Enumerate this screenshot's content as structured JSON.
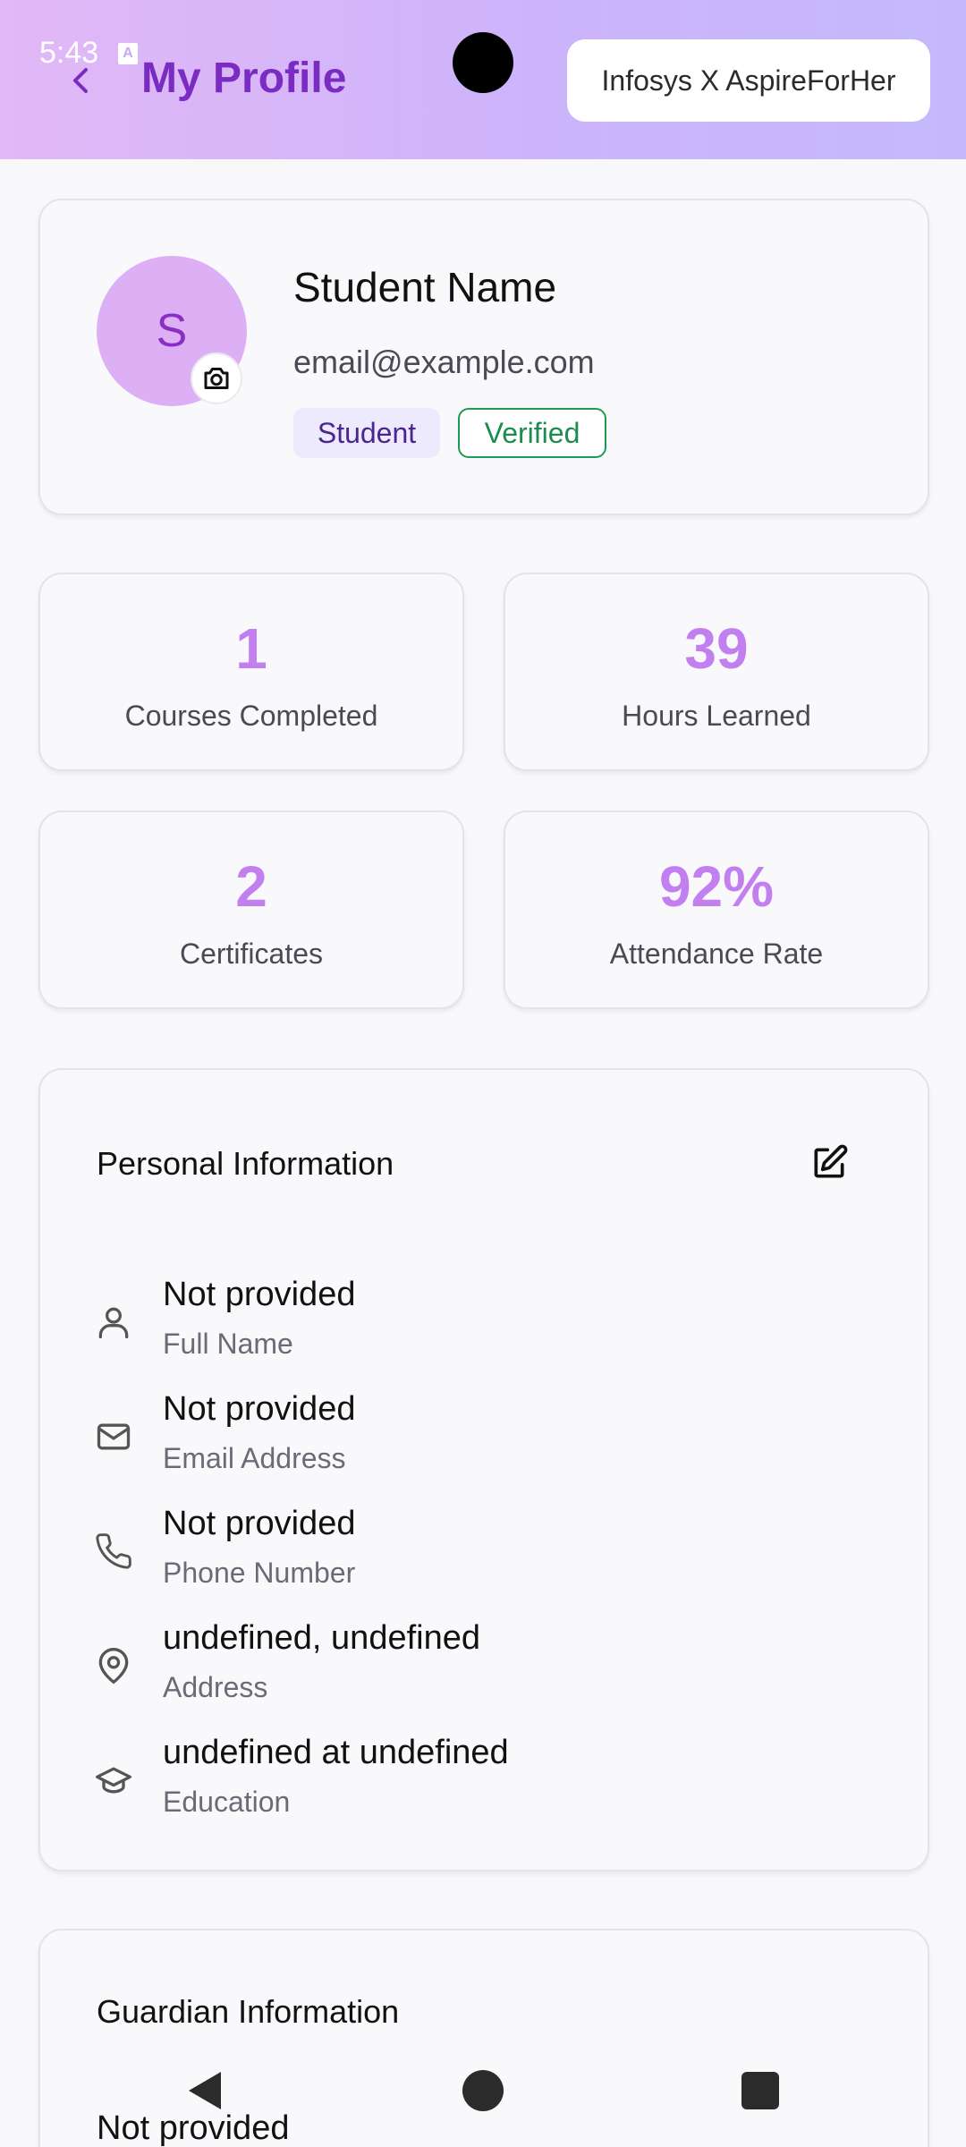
{
  "status_bar": {
    "time": "5:43",
    "notification_glyph": "A"
  },
  "header": {
    "title": "My Profile",
    "brand": "Infosys X AspireForHer",
    "gradient": [
      "#e2b8f7",
      "#c4b8fb"
    ]
  },
  "profile": {
    "avatar_initial": "S",
    "name": "Student Name",
    "email": "email@example.com",
    "role_badge": "Student",
    "status_badge": "Verified"
  },
  "stats": [
    {
      "value": "1",
      "label": "Courses Completed"
    },
    {
      "value": "39",
      "label": "Hours Learned"
    },
    {
      "value": "2",
      "label": "Certificates"
    },
    {
      "value": "92%",
      "label": "Attendance Rate"
    }
  ],
  "personal_info": {
    "title": "Personal Information",
    "rows": [
      {
        "icon": "user-icon",
        "value": "Not provided",
        "label": "Full Name"
      },
      {
        "icon": "mail-icon",
        "value": "Not provided",
        "label": "Email Address"
      },
      {
        "icon": "phone-icon",
        "value": "Not provided",
        "label": "Phone Number"
      },
      {
        "icon": "map-pin-icon",
        "value": "undefined, undefined",
        "label": "Address"
      },
      {
        "icon": "graduation-cap-icon",
        "value": "undefined at undefined",
        "label": "Education"
      }
    ]
  },
  "guardian_info": {
    "title": "Guardian Information",
    "first_value": "Not provided"
  },
  "colors": {
    "accent": "#7a2bc2",
    "stat_value": "#c27ff0",
    "avatar_bg": "#ddb0f6",
    "verified": "#1a8c4d"
  }
}
